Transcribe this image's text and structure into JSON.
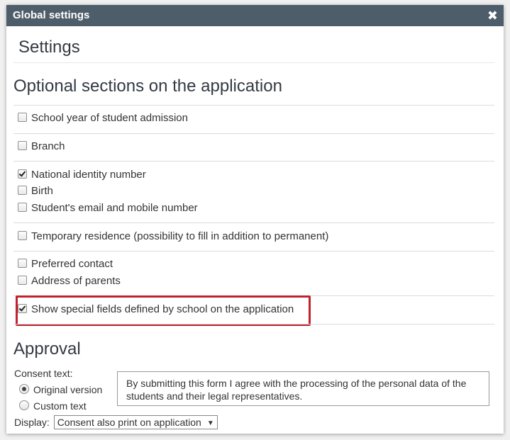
{
  "dialog": {
    "title": "Global settings",
    "close_glyph": "✖"
  },
  "settings": {
    "title": "Settings"
  },
  "optional_sections": {
    "title": "Optional sections on the application",
    "options": [
      {
        "label": "School year of student admission",
        "checked": false
      },
      {
        "label": "Branch",
        "checked": false
      },
      {
        "label": "National identity number",
        "checked": true
      },
      {
        "label": "Birth",
        "checked": false
      },
      {
        "label": "Student's email and mobile number",
        "checked": false
      },
      {
        "label": "Temporary residence (possibility to fill in addition to permanent)",
        "checked": false
      },
      {
        "label": "Preferred contact",
        "checked": false
      },
      {
        "label": "Address of parents",
        "checked": false
      },
      {
        "label": "Show special fields defined by school on the application",
        "checked": true
      }
    ]
  },
  "approval": {
    "title": "Approval",
    "consent_label": "Consent text:",
    "original_version": "Original version",
    "custom_text": "Custom text",
    "selected": "original",
    "consent_text": "By submitting this form I agree with the processing of the personal data of the students and their legal representatives.",
    "display_label": "Display:",
    "display_value": "Consent also print on application"
  },
  "colors": {
    "titlebar": "#4e5d6a",
    "highlight": "#c0222e"
  }
}
